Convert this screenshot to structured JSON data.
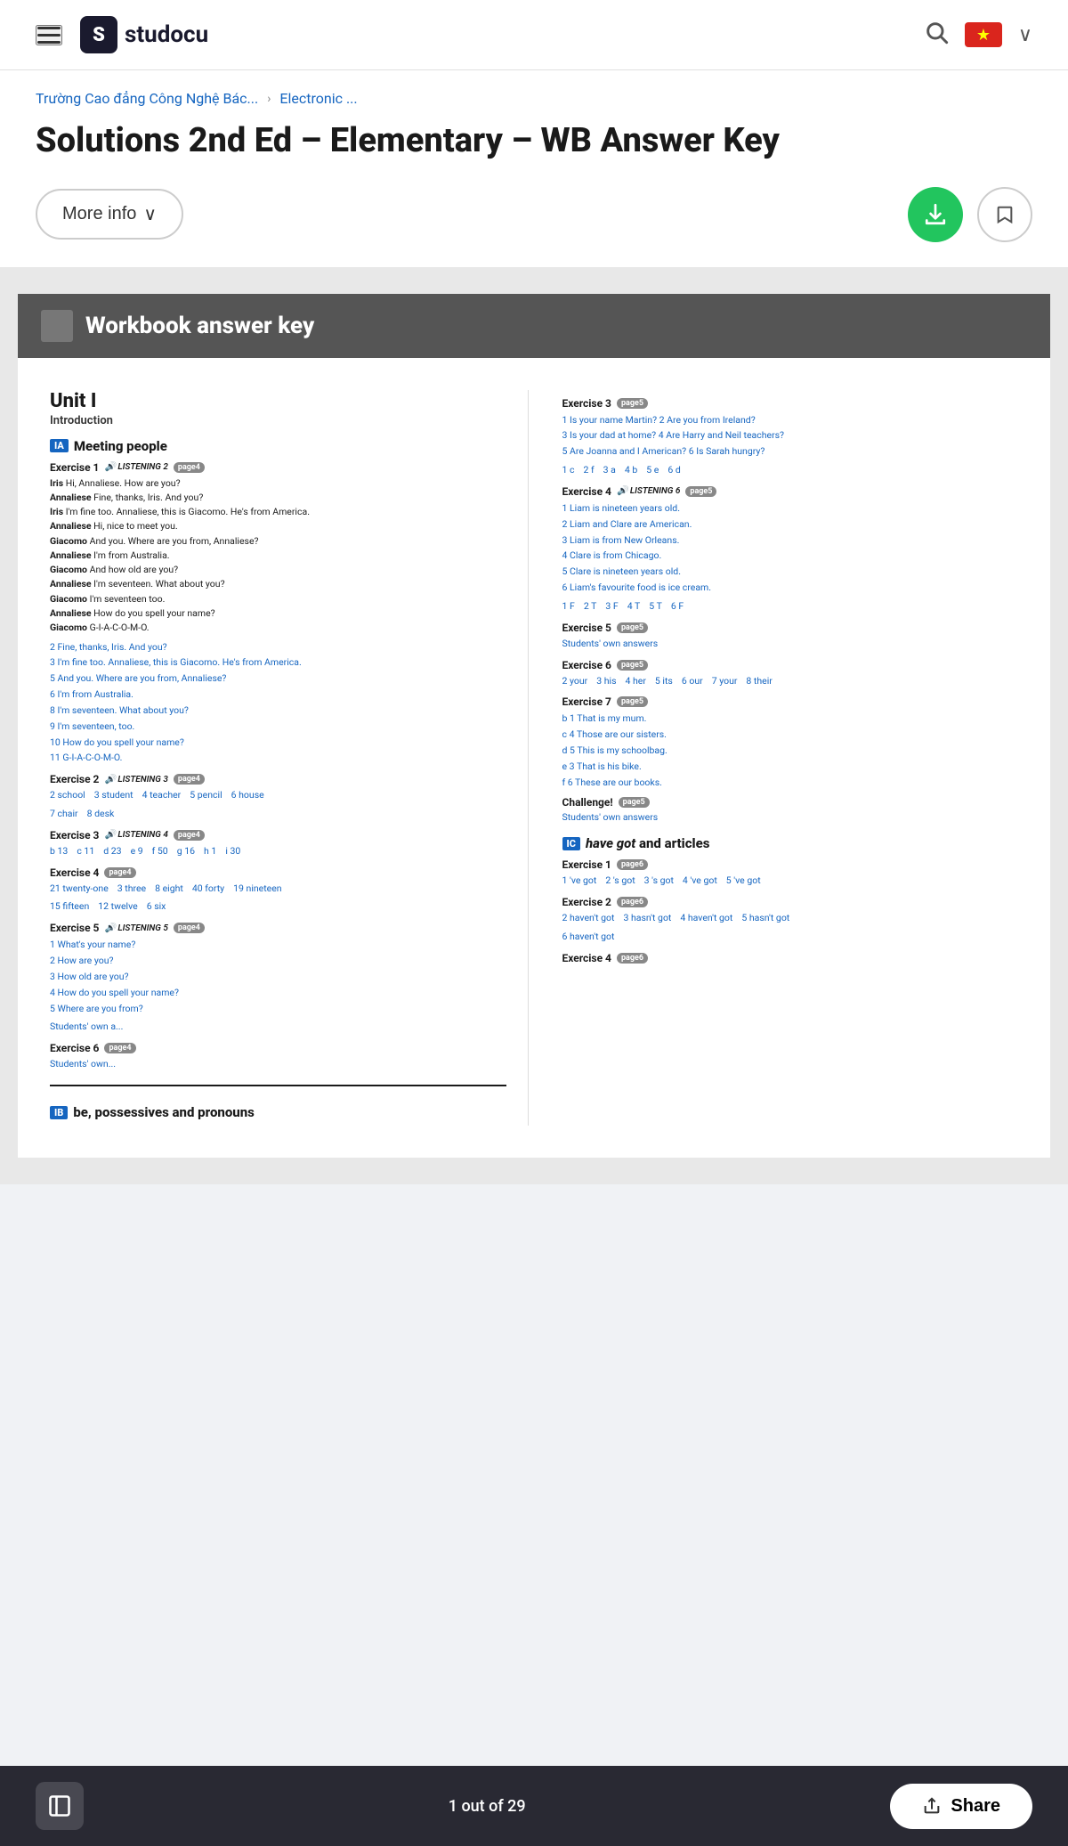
{
  "header": {
    "logo_text": "studocu",
    "search_label": "search",
    "chevron_label": "expand",
    "flag_country": "Vietnam"
  },
  "breadcrumb": {
    "school": "Trường Cao đẳng Công Nghệ Bác...",
    "separator": "›",
    "subject": "Electronic ..."
  },
  "title": "Solutions 2nd Ed – Elementary – WB Answer Key",
  "actions": {
    "more_info": "More info",
    "chevron": "∨",
    "download": "download",
    "bookmark": "bookmark"
  },
  "doc_header": "Workbook answer key",
  "unit": {
    "title": "Unit I",
    "subtitle": "Introduction",
    "section1a": {
      "heading": "Meeting people",
      "badge": "IA",
      "exercise1": {
        "label": "Exercise 1",
        "badge": "LISTENING 2",
        "page": "page4",
        "dialogue": [
          {
            "speaker": "Iris",
            "text": "Hi, Annaliese. How are you?"
          },
          {
            "speaker": "Annaliese",
            "text": "Fine, thanks, Iris. And you?"
          },
          {
            "speaker": "Iris",
            "text": "I'm fine too. Annaliese, this is Giacomo. He's from America."
          },
          {
            "speaker": "Annaliese",
            "text": "Hi, nice to meet you."
          },
          {
            "speaker": "Giacomo",
            "text": "And you. Where are you from, Annaliese?"
          },
          {
            "speaker": "Annaliese",
            "text": "I'm from Australia."
          },
          {
            "speaker": "Giacomo",
            "text": "And how old are you?"
          },
          {
            "speaker": "Annaliese",
            "text": "I'm seventeen. What about you?"
          },
          {
            "speaker": "Giacomo",
            "text": "I'm seventeen too."
          },
          {
            "speaker": "Annaliese",
            "text": "How do you spell your name?"
          },
          {
            "speaker": "Giacomo",
            "text": "G-I-A-C-O-M-O."
          }
        ],
        "answers": [
          "2  Fine, thanks, Iris. And you?",
          "3  I'm fine too. Annaliese, this is Giacomo. He's from America.",
          "5  And you. Where are you from, Annaliese?",
          "6  I'm from Australia.",
          "8  I'm seventeen. What about you?",
          "9  I'm seventeen, too.",
          "10  How do you spell your name?",
          "11  G-I-A-C-O-M-O."
        ]
      },
      "exercise2": {
        "label": "Exercise 2",
        "badge": "LISTENING 3",
        "page": "page4",
        "answers_inline": "2 school   3 student   4 teacher   5 pencil   6 house",
        "answers_inline2": "7 chair   8 desk"
      },
      "exercise3": {
        "label": "Exercise 3",
        "badge": "LISTENING 4",
        "page": "page4",
        "answers_inline": "b 13   c 11   d 23   e 9   f 50   g 16   h 1   i 30"
      },
      "exercise4": {
        "label": "Exercise 4",
        "page": "page4",
        "answers_inline": "21 twenty-one   3 three   8 eight   40 forty   19 nineteen",
        "answers_inline2": "15 fifteen   12 twelve   6 six"
      },
      "exercise5": {
        "label": "Exercise 5",
        "badge": "LISTENING 5",
        "page": "page4",
        "answers": [
          "1  What's your name?",
          "2  How are you?",
          "3  How old are you?",
          "4  How do you spell your name?",
          "5  Where are you from?"
        ],
        "extra": "Students' own a..."
      },
      "exercise6": {
        "label": "Exercise 6",
        "page": "page4",
        "extra": "Students' own..."
      }
    },
    "section1b": {
      "heading": "be, possessives and pronouns",
      "badge": "IB"
    }
  },
  "right_col": {
    "exercise3_right": {
      "label": "Exercise 3",
      "page": "page5",
      "q1": "1  Is your name Martin?",
      "q2": "2  Are you from Ireland?",
      "q3": "3  Is your dad at home?",
      "q4": "4  Are Harry and Neil teachers?",
      "q5": "5  Are Joanna and I American?",
      "q6": "6  Is Sarah hungry?",
      "answers": "1 c   2 f   3 a   4 b   5 e   6 d"
    },
    "exercise4_right": {
      "label": "Exercise 4",
      "badge": "LISTENING 6",
      "page": "page5",
      "items": [
        "1  Liam is nineteen years old.",
        "2  Liam and Clare are American.",
        "3  Liam is from New Orleans.",
        "4  Clare is from Chicago.",
        "5  Clare is nineteen years old.",
        "6  Liam's favourite food is ice cream."
      ],
      "answers": "1 F   2 T   3 F   4 T   5 T   6 F"
    },
    "exercise5_right": {
      "label": "Exercise 5",
      "page": "page5",
      "text": "Students' own answers"
    },
    "exercise6_right": {
      "label": "Exercise 6",
      "page": "page5",
      "answers": "2 your   3 his   4 her   5 its   6 our   7 your   8 their"
    },
    "exercise7_right": {
      "label": "Exercise 7",
      "page": "page5",
      "items": [
        "b 1  That is my mum.",
        "c 4  Those are our sisters.",
        "d 5  This is my schoolbag.",
        "e 3  That is his bike.",
        "f 6  These are our books."
      ]
    },
    "challenge_right": {
      "label": "Challenge!",
      "page": "page5",
      "text": "Students' own answers"
    },
    "section1c": {
      "badge": "IC",
      "heading": "have got and articles",
      "exercise1": {
        "label": "Exercise 1",
        "page": "page6",
        "answers": "1 've got   2 's got   3 's got   4 've got   5 've got"
      },
      "exercise2": {
        "label": "Exercise 2",
        "page": "page6",
        "answers": "2 haven't got   3 hasn't got   4 haven't got   5 hasn't got",
        "answers2": "6 haven't got"
      },
      "exercise4_1c": {
        "label": "Exercise 4",
        "page": "page6"
      }
    }
  },
  "bottom_bar": {
    "page_counter": "1 out of 29",
    "share_label": "Share"
  }
}
